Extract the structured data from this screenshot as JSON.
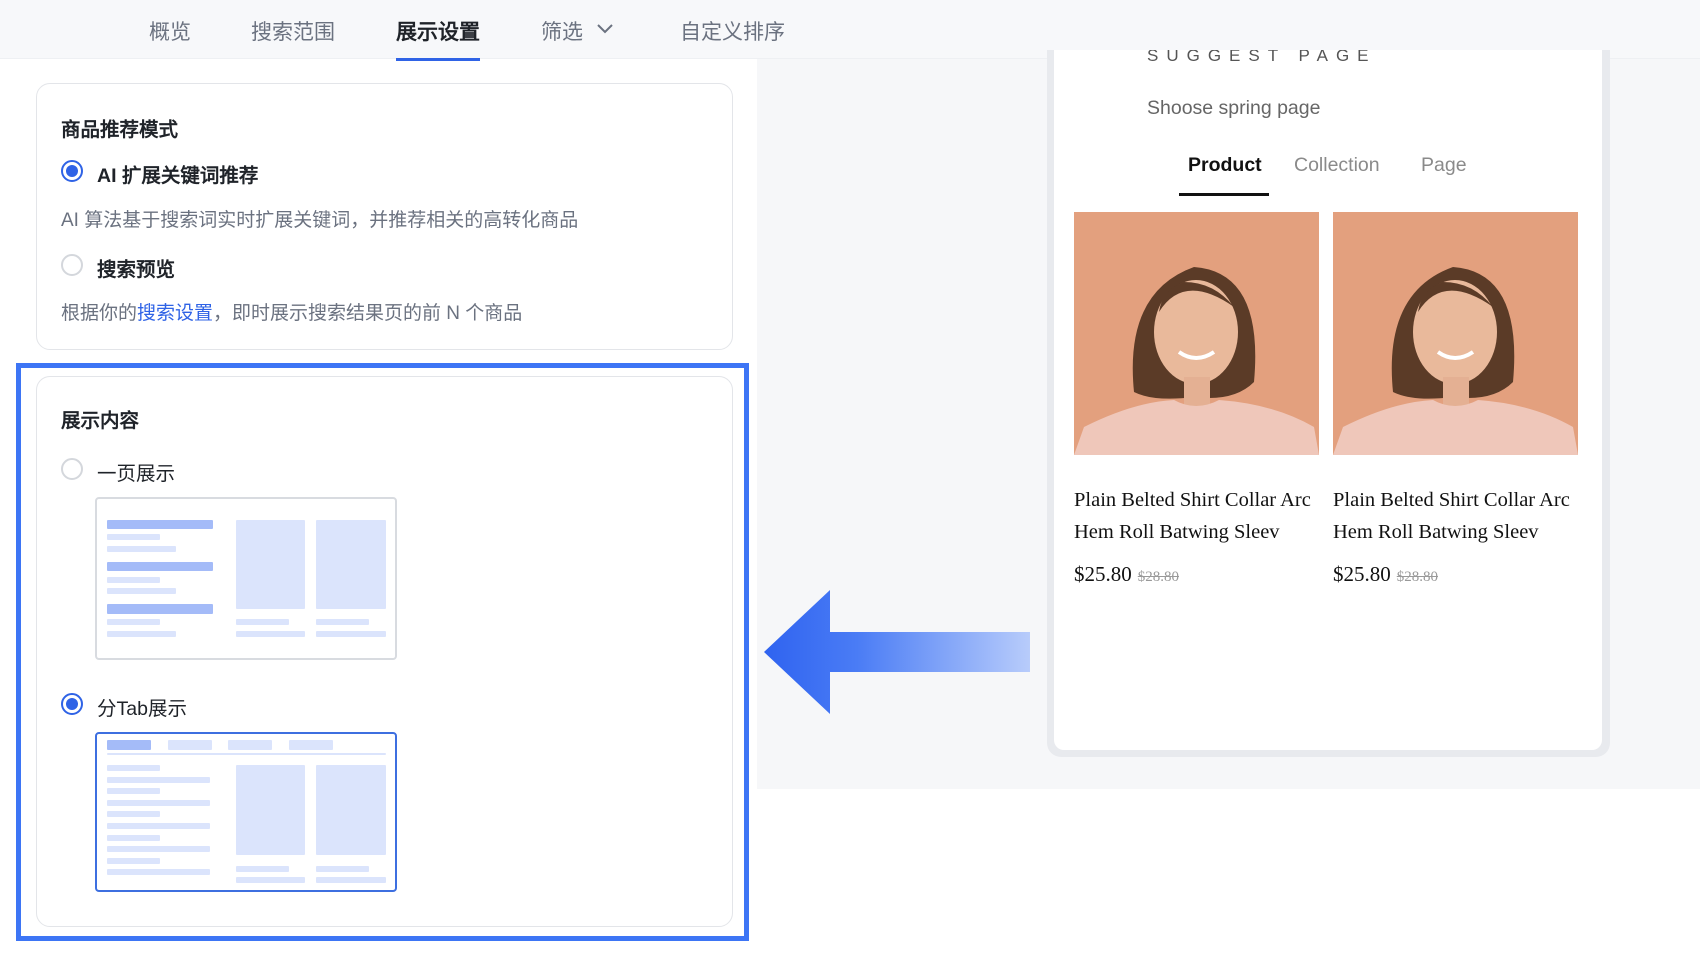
{
  "nav": {
    "tabs": [
      {
        "label": "概览"
      },
      {
        "label": "搜索范围"
      },
      {
        "label": "展示设置",
        "active": true
      },
      {
        "label": "筛选"
      },
      {
        "label": "自定义排序"
      }
    ]
  },
  "recommend_card": {
    "title": "商品推荐模式",
    "options": [
      {
        "label": "AI 扩展关键词推荐",
        "selected": true,
        "desc": "AI 算法基于搜索词实时扩展关键词，并推荐相关的高转化商品"
      },
      {
        "label": "搜索预览",
        "selected": false,
        "desc_prefix": "根据你的",
        "desc_link": "搜索设置",
        "desc_suffix": "，即时展示搜索结果页的前 N 个商品"
      }
    ]
  },
  "display_card": {
    "title": "展示内容",
    "options": [
      {
        "label": "一页展示",
        "selected": false
      },
      {
        "label": "分Tab展示",
        "selected": true
      }
    ]
  },
  "preview": {
    "heading": "SUGGEST PAGE",
    "subtitle": "Shoose spring page",
    "tabs": [
      "Product",
      "Collection",
      "Page"
    ],
    "active_tab": "Product",
    "products": [
      {
        "title_line1": "Plain Belted Shirt Collar Arc",
        "title_line2": "Hem Roll Batwing Sleev",
        "price": "$25.80",
        "original_price": "$28.80"
      },
      {
        "title_line1": "Plain Belted Shirt Collar Arc",
        "title_line2": "Hem Roll Batwing Sleev",
        "price": "$25.80",
        "original_price": "$28.80"
      }
    ]
  },
  "colors": {
    "accent": "#2f63e6",
    "highlight": "#3d75f5"
  }
}
